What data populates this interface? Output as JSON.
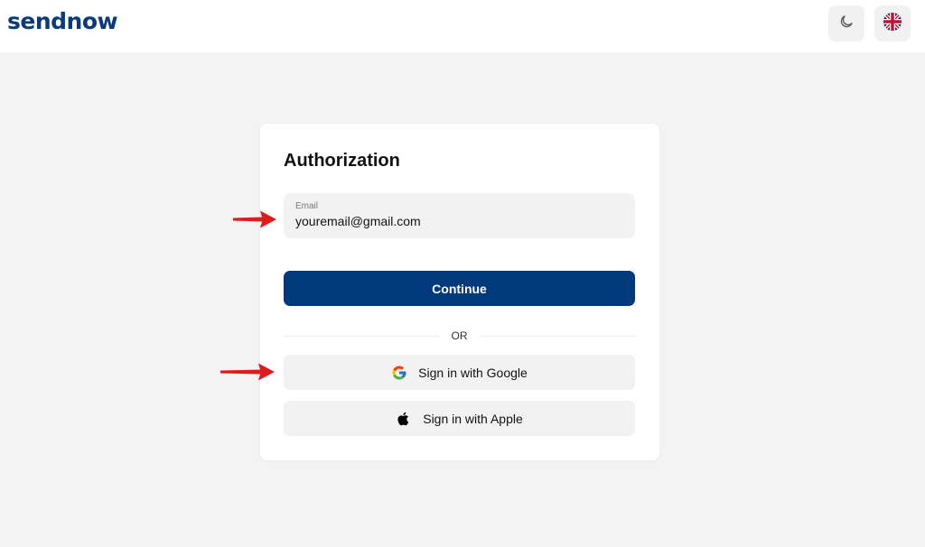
{
  "header": {
    "logo_text": "sendnow",
    "theme_toggle_icon": "moon-icon",
    "language_icon": "uk-flag-icon"
  },
  "auth": {
    "title": "Authorization",
    "email_label": "Email",
    "email_value": "youremail@gmail.com",
    "continue_label": "Continue",
    "divider_text": "OR",
    "google_label": "Sign in with Google",
    "apple_label": "Sign in with Apple"
  },
  "annotations": {
    "arrow_icon": "red-arrow-icon"
  },
  "colors": {
    "brand": "#003a7d",
    "background": "#f3f3f3",
    "field": "#f2f2f2",
    "arrow": "#e01b1b"
  }
}
